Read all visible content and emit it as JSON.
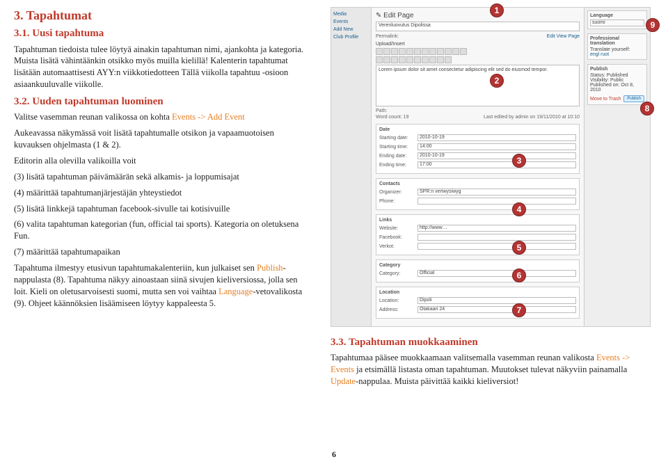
{
  "left": {
    "h_main": "3. Tapahtumat",
    "h_31": "3.1. Uusi tapahtuma",
    "p_31a": "Tapahtuman tiedoista tulee löytyä ainakin tapahtuman nimi, ajankohta ja kategoria. Muista lisätä vähintäänkin otsikko myös muilla kielillä! Kalenterin tapahtumat lisätään automaattisesti AYY:n viikkotiedotteen Tällä viikolla tapahtuu -osioon asiaankuuluvalle viikolle.",
    "h_32": "3.2. Uuden tapahtuman luominen",
    "p_32a_pre": "Valitse vasemman reunan valikossa on kohta ",
    "p_32a_link": "Events -> Add Event",
    "p_32b": "Aukeavassa näkymässä voit lisätä tapahtumalle otsikon ja vapaamuotoisen kuvauksen ohjelmasta (1 & 2).",
    "p_32c": "Editorin alla olevilla valikoilla voit",
    "li3": "(3) lisätä tapahtuman päivämäärän sekä alkamis- ja loppumisajat",
    "li4": "(4) määrittää tapahtumanjärjestäjän yhteystiedot",
    "li5": "(5) lisätä linkkejä tapahtuman facebook-sivulle tai kotisivuille",
    "li6": "(6) valita tapahtuman kategorian (fun, official tai sports). Kategoria on oletuksena Fun.",
    "li7": "(7) määrittää tapahtumapaikan",
    "p_32d_pre": "Tapahtuma ilmestyy etusivun tapahtumakalenteriin, kun julkaiset sen ",
    "p_32d_pub": "Publish",
    "p_32d_post": "-nappulasta (8). Tapahtuma näkyy ainoastaan siinä sivujen kieliversiossa, jolla sen loit. Kieli on oletusarvoisesti suomi, mutta sen voi vaihtaa ",
    "p_32d_lang": "Language",
    "p_32d_end": "-vetovalikosta (9). Ohjeet käännöksien lisäämiseen löytyy kappaleesta 5."
  },
  "screenshot": {
    "sidebar": [
      "Media",
      "Events",
      "Add New",
      "Club Profile"
    ],
    "edit_page": "Edit Page",
    "post_title": "Verenluovutus Dipolissa",
    "perma": "Permalink:",
    "buttons": "Edit  View Page",
    "upload": "Upload/Insert",
    "editor_body": "Lorem ipsum dolor sit amet consectetur adipiscing elit sed do eiusmod tempor.",
    "path": "Path:",
    "wordcount": "Word count: 19",
    "lastedit": "Last edited by admin on 19/11/2010 at 10:10",
    "date_hd": "Date",
    "date_start": "Starting date:",
    "date_start_v": "2010-10-19",
    "time_start": "Starting time:",
    "time_start_v": "14:00",
    "date_end": "Ending date:",
    "date_end_v": "2010-10-19",
    "time_end": "Ending time:",
    "time_end_v": "17:00",
    "contacts_hd": "Contacts",
    "org": "Organizer:",
    "org_v": "SPR:n veriwysiwyg",
    "phone": "Phone:",
    "links_hd": "Links",
    "website": "Website:",
    "website_v": "http://www…",
    "facebook": "Facebook:",
    "verkot": "Verkot:",
    "category_hd": "Category",
    "category_lbl": "Category:",
    "category_v": "Official",
    "location_hd": "Location",
    "loc_lbl": "Location:",
    "loc_v": "Dipoli",
    "addr_lbl": "Address:",
    "addr_v": "Otakaari 24",
    "lang_hd": "Language",
    "lang_v": "suomi",
    "prof_hd": "Professional translation",
    "trans_lbl": "Translate yourself:",
    "trans_v": "engl  ruot",
    "publish_hd": "Publish",
    "status": "Status: Published",
    "vis": "Visibility: Public",
    "pubon": "Published on: Oct 8, 2010",
    "trash": "Move to Trash",
    "publish_btn": "Publish"
  },
  "right_text": {
    "h_33": "3.3. Tapahtuman muokkaaminen",
    "p_33_pre": "Tapahtumaa pääsee muokkaamaan valitsemalla vasemman reunan valikosta ",
    "p_33_link": "Events -> Events",
    "p_33_mid": " ja etsimällä listasta oman tapahtuman. Muutokset tulevat näkyviin painamalla ",
    "p_33_upd": "Update",
    "p_33_end": "-nappulaa. Muista päivittää kaikki kieliversiot!"
  },
  "pagenum": "6",
  "badges": [
    "1",
    "2",
    "3",
    "4",
    "5",
    "6",
    "7",
    "8",
    "9"
  ]
}
